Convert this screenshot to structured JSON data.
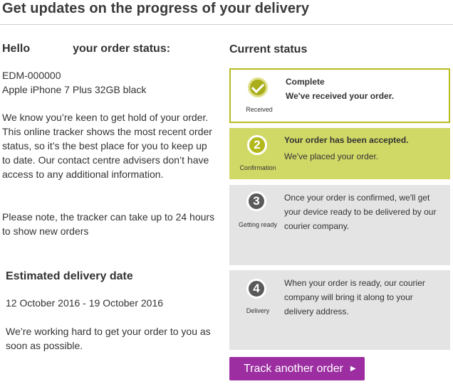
{
  "header": {
    "title": "Get updates on the progress of your delivery"
  },
  "left": {
    "hello_prefix": "Hello",
    "hello_suffix": "your order status:",
    "order_ref": "EDM-000000",
    "product": "Apple iPhone 7 Plus 32GB black",
    "para1": "We know you’re keen to get hold of your order. This online tracker shows the most recent order status, so it’s the best place for you to keep up to date. Our contact centre advisers don’t have access to any additional information.",
    "para2": "Please note, the tracker can take up to 24 hours to show new orders",
    "est_heading": "Estimated delivery date",
    "est_dates": "12 October 2016 - 19 October 2016",
    "est_para": "We’re working hard to get your order to you as soon as possible."
  },
  "status": {
    "heading": "Current status",
    "steps": [
      {
        "number": "",
        "icon": "check-icon",
        "caption": "Received",
        "title": "Complete",
        "text": "We've received your order."
      },
      {
        "number": "2",
        "caption": "Confirmation",
        "title": "Your order has been accepted.",
        "text": "We've placed your order."
      },
      {
        "number": "3",
        "caption": "Getting ready",
        "title": "",
        "text": "Once your order is confirmed, we'll get your device ready to be delivered by our courier company."
      },
      {
        "number": "4",
        "caption": "Delivery",
        "title": "",
        "text": "When your order is ready, our courier company will bring it along to your delivery address."
      }
    ],
    "colors": {
      "complete_border": "#b8bb1f",
      "active_bg": "#d1d966",
      "pending_bg": "#e4e4e4",
      "button": "#9c2ea1"
    }
  },
  "actions": {
    "track_label": "Track another order",
    "track_icon": "arrow-right-icon"
  }
}
